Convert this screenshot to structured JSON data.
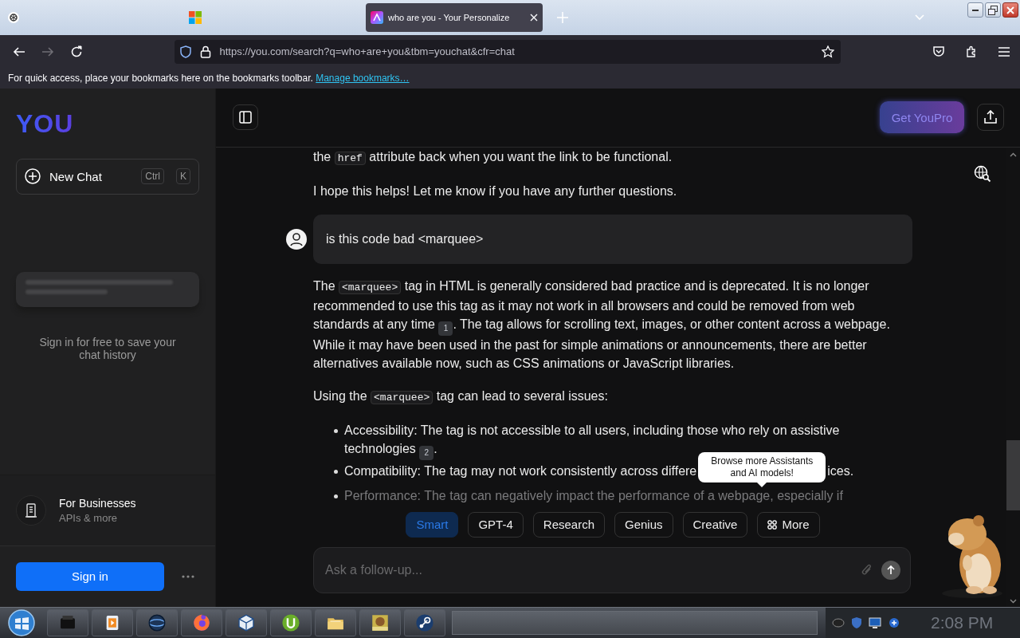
{
  "browser": {
    "tabs": [
      {
        "selected": false
      },
      {
        "selected": false
      },
      {
        "title": "who are you - Your Personalize",
        "selected": true
      }
    ],
    "forward_disabled": true,
    "url": "https://you.com/search?q=who+are+you&tbm=youchat&cfr=chat",
    "bookmarks_hint": "For quick access, place your bookmarks here on the bookmarks toolbar.",
    "bookmarks_link": "Manage bookmarks…"
  },
  "sidebar": {
    "logo": "YOU",
    "new_chat": {
      "label": "New Chat",
      "keys": [
        "Ctrl",
        "K"
      ]
    },
    "history_hint": "Sign in for free to save your chat history",
    "businesses": {
      "title": "For Businesses",
      "subtitle": "APIs & more"
    },
    "sign_in": "Sign in"
  },
  "header": {
    "pro_button": "Get YouPro"
  },
  "previous_answer": [
    {
      "kind": "paragraph",
      "segments": [
        {
          "kind": "text",
          "text": "the "
        },
        {
          "kind": "code",
          "text": "href"
        },
        {
          "kind": "text",
          "text": " attribute back when you want the link to be functional."
        }
      ]
    },
    {
      "kind": "paragraph",
      "segments": [
        {
          "kind": "text",
          "text": "I hope this helps! Let me know if you have any further questions."
        }
      ]
    }
  ],
  "question": "is this code bad <marquee>",
  "answer": [
    {
      "kind": "paragraph",
      "segments": [
        {
          "kind": "text",
          "text": "The "
        },
        {
          "kind": "code",
          "text": "<marquee>"
        },
        {
          "kind": "text",
          "text": " tag in HTML is generally considered bad practice and is deprecated. It is no longer recommended to use this tag as it may not work in all browsers and could be removed from web standards at any time "
        },
        {
          "kind": "cite",
          "text": "1"
        },
        {
          "kind": "text",
          "text": ". The tag allows for scrolling text, images, or other content across a webpage. While it may have been used in the past for simple animations or announcements, there are better alternatives available now, such as CSS animations or JavaScript libraries."
        }
      ]
    },
    {
      "kind": "paragraph",
      "segments": [
        {
          "kind": "text",
          "text": "Using the "
        },
        {
          "kind": "code",
          "text": "<marquee>"
        },
        {
          "kind": "text",
          "text": " tag can lead to several issues:"
        }
      ]
    },
    {
      "kind": "list",
      "items": [
        {
          "segments": [
            {
              "kind": "text",
              "text": "Accessibility: The tag is not accessible to all users, including those who rely on assistive technologies "
            },
            {
              "kind": "cite",
              "text": "2"
            },
            {
              "kind": "text",
              "text": "."
            }
          ]
        },
        {
          "segments": [
            {
              "kind": "text",
              "text": "Compatibility: The tag may not work consistently across differe"
            },
            {
              "kind": "tooltip",
              "text": "Browse more Assistants and AI models!"
            },
            {
              "kind": "text",
              "text": "ices."
            }
          ]
        },
        {
          "segments": [
            {
              "kind": "text",
              "text": "Performance: The tag can negatively impact the performance of a webpage, especially if"
            }
          ]
        }
      ]
    }
  ],
  "modes": [
    {
      "kind": "mode",
      "label": "Smart",
      "selected": true
    },
    {
      "kind": "mode",
      "label": "GPT-4",
      "selected": false
    },
    {
      "kind": "mode",
      "label": "Research",
      "selected": false
    },
    {
      "kind": "mode",
      "label": "Genius",
      "selected": false
    },
    {
      "kind": "mode",
      "label": "Creative",
      "selected": false
    },
    {
      "kind": "more",
      "label": "More",
      "selected": false
    }
  ],
  "input": {
    "placeholder": "Ask a follow-up..."
  },
  "taskbar": {
    "clock": "2:08 PM"
  }
}
